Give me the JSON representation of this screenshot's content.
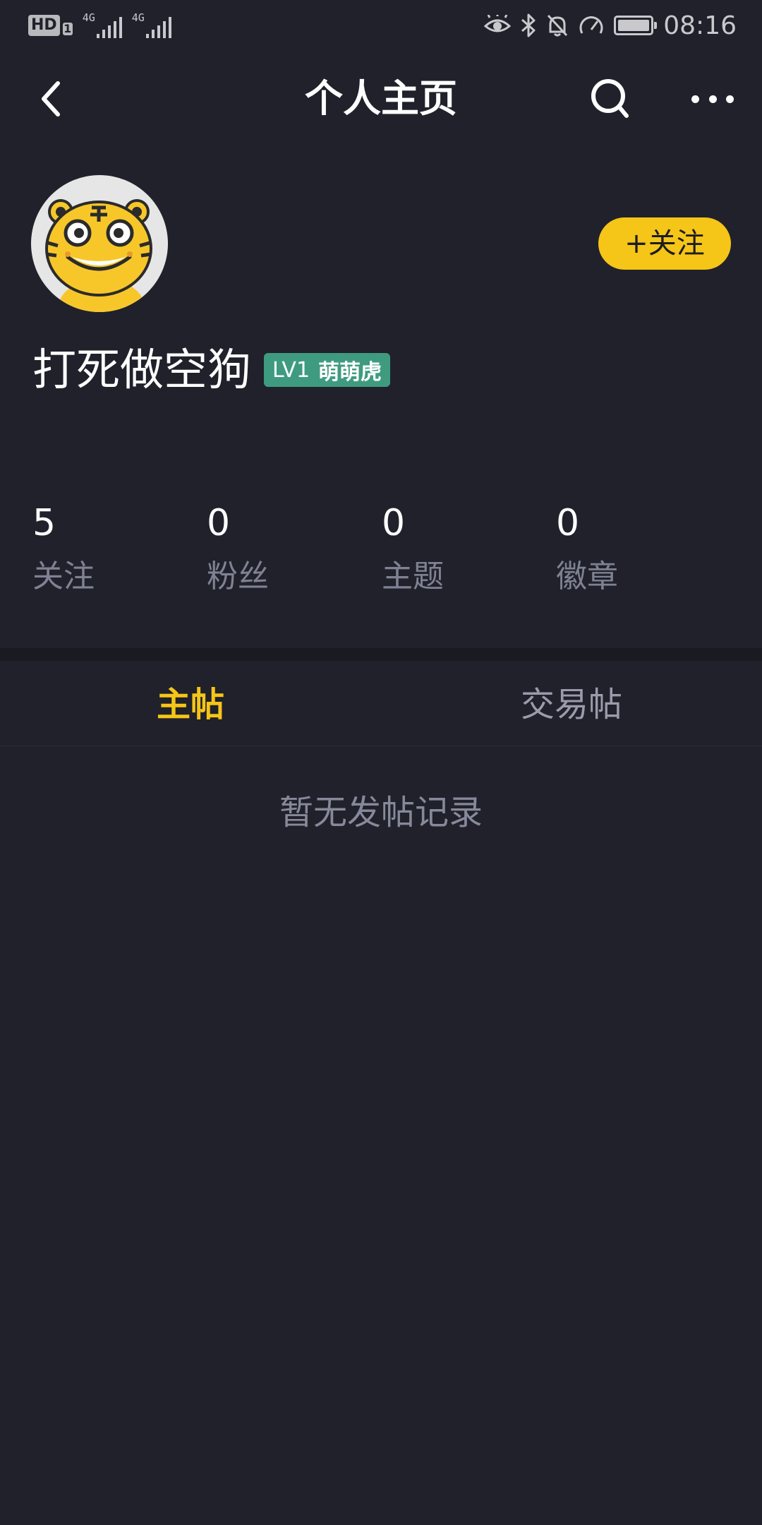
{
  "status_bar": {
    "hd_label": "HD",
    "sim_label": "1",
    "network_1": "4G",
    "network_2": "4G",
    "time": "08:16",
    "battery_level": 1.0,
    "icons": [
      "eye-icon",
      "bluetooth-icon",
      "bell-off-icon",
      "speed-icon",
      "battery-icon"
    ]
  },
  "nav": {
    "title": "个人主页",
    "back_icon": "chevron-left-icon",
    "search_icon": "search-icon",
    "more_icon": "more-icon"
  },
  "profile": {
    "avatar": "tiger-avatar",
    "username": "打死做空狗",
    "level": "LV1",
    "level_name": "萌萌虎",
    "follow_label": "+关注"
  },
  "stats": [
    {
      "value": "5",
      "label": "关注"
    },
    {
      "value": "0",
      "label": "粉丝"
    },
    {
      "value": "0",
      "label": "主题"
    },
    {
      "value": "0",
      "label": "徽章"
    }
  ],
  "tabs": [
    {
      "label": "主帖",
      "active": true
    },
    {
      "label": "交易帖",
      "active": false
    }
  ],
  "empty_state": "暂无发帖记录",
  "colors": {
    "background": "#20212b",
    "accent": "#f5c518",
    "level_badge": "#3f9b80",
    "muted_text": "#7f8293"
  }
}
